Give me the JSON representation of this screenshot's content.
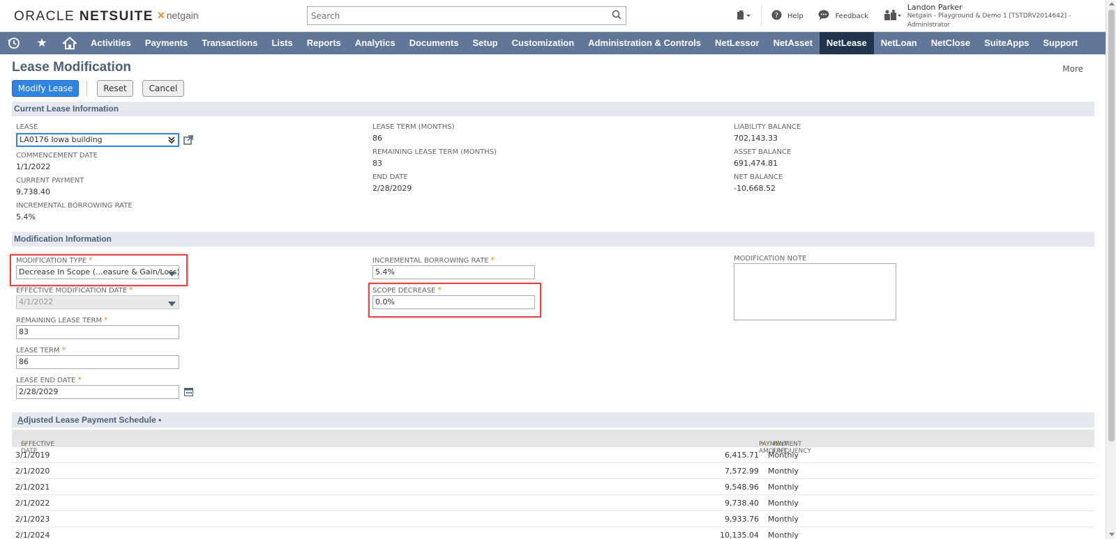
{
  "header": {
    "logo_oracle": "ORACLE",
    "logo_netsuite": "NETSUITE",
    "logo_netgain": "netgain",
    "search_placeholder": "Search",
    "help_label": "Help",
    "feedback_label": "Feedback",
    "user_name": "Landon Parker",
    "user_account": "Netgain - Playground & Demo 1 [TSTDRV2014642] - Administrator"
  },
  "nav": {
    "items": [
      "Activities",
      "Payments",
      "Transactions",
      "Lists",
      "Reports",
      "Analytics",
      "Documents",
      "Setup",
      "Customization",
      "Administration & Controls",
      "NetLessor",
      "NetAsset",
      "NetLease",
      "NetLoan",
      "NetClose",
      "SuiteApps",
      "Support"
    ],
    "active": "NetLease"
  },
  "page": {
    "title": "Lease Modification",
    "more_label": "More",
    "buttons": {
      "modify": "Modify Lease",
      "reset": "Reset",
      "cancel": "Cancel"
    }
  },
  "current_lease": {
    "section_title": "Current Lease Information",
    "lease_label": "LEASE",
    "lease_value": "LA0176 Iowa building",
    "commencement_label": "COMMENCEMENT DATE",
    "commencement_value": "1/1/2022",
    "current_payment_label": "CURRENT PAYMENT",
    "current_payment_value": "9,738.40",
    "ibr_label": "INCREMENTAL BORROWING RATE",
    "ibr_value": "5.4%",
    "lease_term_label": "LEASE TERM (MONTHS)",
    "lease_term_value": "86",
    "remaining_term_label": "REMAINING LEASE TERM (MONTHS)",
    "remaining_term_value": "83",
    "end_date_label": "END DATE",
    "end_date_value": "2/28/2029",
    "liability_label": "LIABILITY BALANCE",
    "liability_value": "702,143.33",
    "asset_label": "ASSET BALANCE",
    "asset_value": "691,474.81",
    "net_label": "NET BALANCE",
    "net_value": "-10,668.52"
  },
  "modification": {
    "section_title": "Modification Information",
    "type_label": "MODIFICATION TYPE",
    "type_value": "Decrease In Scope (...easure & Gain/Loss)",
    "effective_date_label": "EFFECTIVE MODIFICATION DATE",
    "effective_date_value": "4/1/2022",
    "remaining_term_label": "REMAINING LEASE TERM",
    "remaining_term_value": "83",
    "lease_term_label": "LEASE TERM",
    "lease_term_value": "86",
    "end_date_label": "LEASE END DATE",
    "end_date_value": "2/28/2029",
    "ibr_label": "INCREMENTAL BORROWING RATE",
    "ibr_value": "5.4%",
    "scope_decrease_label": "SCOPE DECREASE",
    "scope_decrease_value": "0.0%",
    "note_label": "MODIFICATION NOTE",
    "required_marker": "*"
  },
  "schedule": {
    "section_title_first": "A",
    "section_title_rest": "djusted Lease Payment Schedule",
    "section_title_dot": "•",
    "col_effective_date": "EFFECTIVE DATE",
    "col_payment_amount": "PAYMENT AMOUNT",
    "col_payment_frequency": "PAYMENT FREQUENCY",
    "rows": [
      {
        "date": "3/1/2019",
        "amount": "6,415.71",
        "freq": "Monthly"
      },
      {
        "date": "2/1/2020",
        "amount": "7,572.99",
        "freq": "Monthly"
      },
      {
        "date": "2/1/2021",
        "amount": "9,548.96",
        "freq": "Monthly"
      },
      {
        "date": "2/1/2022",
        "amount": "9,738.40",
        "freq": "Monthly"
      },
      {
        "date": "2/1/2023",
        "amount": "9,933.76",
        "freq": "Monthly"
      },
      {
        "date": "2/1/2024",
        "amount": "10,135.04",
        "freq": "Monthly"
      }
    ]
  }
}
